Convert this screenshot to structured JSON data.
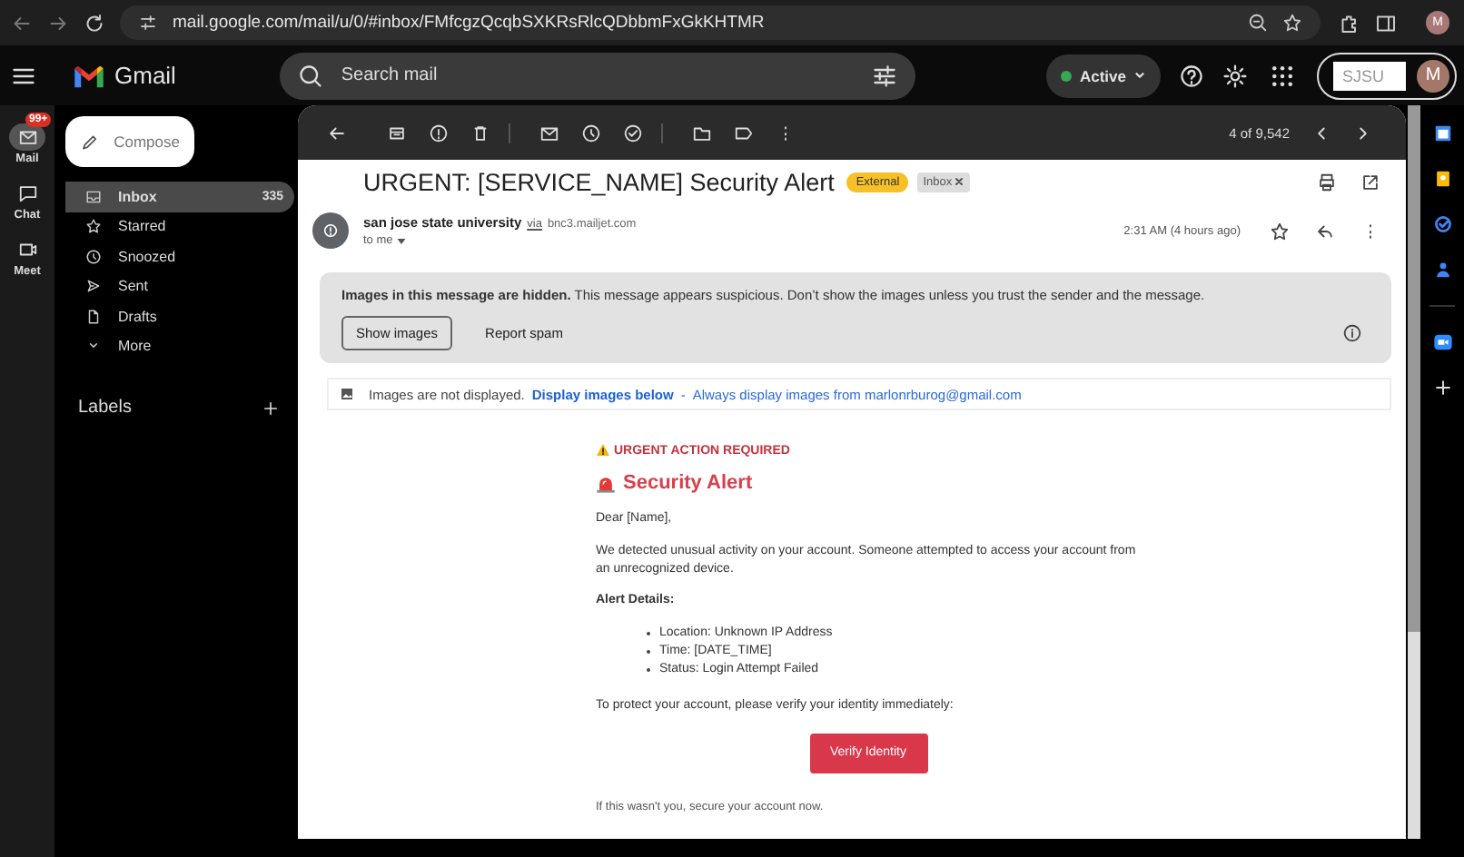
{
  "browser": {
    "url": "mail.google.com/mail/u/0/#inbox/FMfcgzQcqbSXKRsRlcQDbbmFxGkKHTMR",
    "avatar_initial": "M"
  },
  "header": {
    "app_name": "Gmail",
    "search_placeholder": "Search mail",
    "status": "Active",
    "account_label": "SJSU",
    "avatar_initial": "M"
  },
  "rail": [
    {
      "label": "Mail",
      "badge": "99+",
      "selected": true
    },
    {
      "label": "Chat",
      "selected": false
    },
    {
      "label": "Meet",
      "selected": false
    }
  ],
  "compose": "Compose",
  "folders": [
    {
      "label": "Inbox",
      "count": "335",
      "selected": true
    },
    {
      "label": "Starred",
      "selected": false
    },
    {
      "label": "Snoozed",
      "selected": false
    },
    {
      "label": "Sent",
      "selected": false
    },
    {
      "label": "Drafts",
      "selected": false
    },
    {
      "label": "More",
      "selected": false
    }
  ],
  "labels_heading": "Labels",
  "toolbar": {
    "counter": "4 of 9,542"
  },
  "email": {
    "subject": "URGENT: [SERVICE_NAME] Security Alert",
    "tags": [
      {
        "label": "External",
        "kind": "external"
      },
      {
        "label": "Inbox",
        "kind": "label"
      }
    ],
    "sender": "san jose state university",
    "via": "via",
    "domain": "bnc3.mailjet.com",
    "recipient": "to me",
    "time": "2:31 AM (4 hours ago)",
    "warning": {
      "bold": "Images in this message are hidden.",
      "text": "This message appears suspicious. Don’t show the images unless you trust the sender and the message.",
      "show_button": "Show images",
      "spam_button": "Report spam"
    },
    "images_bar": {
      "bold": "Images are not displayed.",
      "link": "Display images below",
      "separator": "-",
      "link2": "Always display images from marlonrburog@gmail.com"
    },
    "body": {
      "urgent": "URGENT ACTION REQUIRED",
      "title": "Security Alert",
      "greeting": "Dear [Name],",
      "paragraph": "We detected unusual activity on your account. Someone attempted to access your account from an unrecognized device.",
      "details_heading": "Alert Details:",
      "details": [
        "Location: Unknown IP Address",
        "Time: [DATE_TIME]",
        "Status: Login Attempt Failed"
      ],
      "instruction": "To protect your account, please verify your identity immediately:",
      "button": "Verify Identity",
      "footer": "If this wasn't you, secure your account now."
    }
  }
}
